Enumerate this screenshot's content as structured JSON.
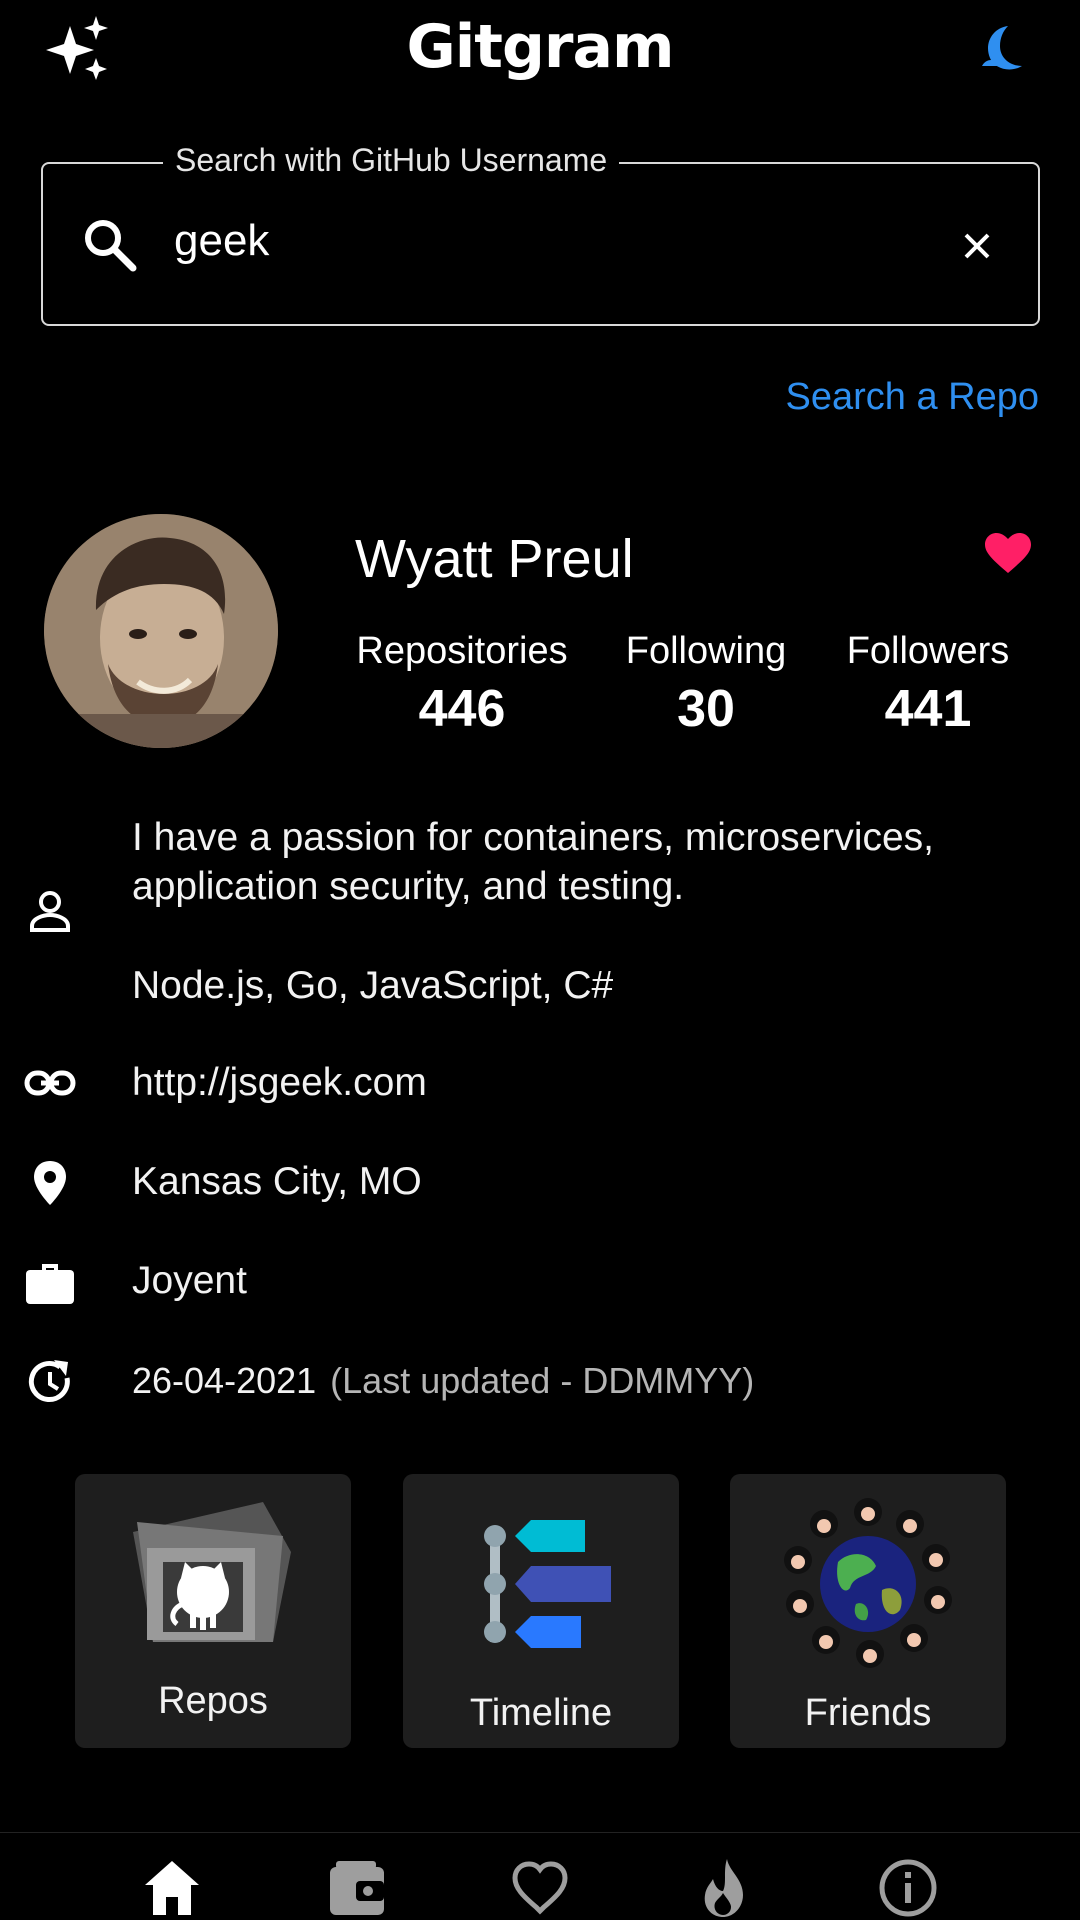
{
  "app": {
    "title": "Gitgram"
  },
  "search": {
    "legend": "Search with GitHub Username",
    "value": "geek"
  },
  "search_repo_link": "Search a Repo",
  "profile": {
    "name": "Wyatt Preul",
    "stats": [
      {
        "label": "Repositories",
        "value": "446"
      },
      {
        "label": "Following",
        "value": "30"
      },
      {
        "label": "Followers",
        "value": "441"
      }
    ],
    "bio_line1": "I have a passion for containers, microservices,",
    "bio_line2": "application security, and testing.",
    "bio_line3": "Node.js, Go, JavaScript, C#",
    "website": "http://jsgeek.com",
    "location": "Kansas City, MO",
    "company": "Joyent",
    "updated_date": "26-04-2021",
    "updated_note": "(Last updated - DDMMYY)"
  },
  "cards": [
    {
      "label": "Repos",
      "icon": "github-repo-icon"
    },
    {
      "label": "Timeline",
      "icon": "timeline-icon"
    },
    {
      "label": "Friends",
      "icon": "friends-globe-icon"
    }
  ],
  "bottom_nav": [
    "home-icon",
    "wallet-icon",
    "heart-outline-icon",
    "flame-icon",
    "info-icon"
  ],
  "colors": {
    "accent": "#2f8ff0",
    "heart": "#ff1f66",
    "card_bg": "#1e1e1e"
  }
}
